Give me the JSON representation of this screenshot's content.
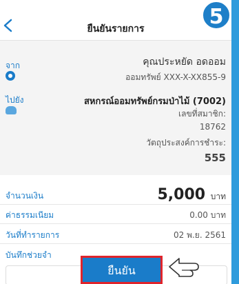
{
  "header": {
    "title": "ยืนยันรายการ",
    "step_number": "5"
  },
  "from": {
    "label": "จาก",
    "name": "คุณประหยัด อดออม",
    "account": "ออมทรัพย์ XXX-X-XX855-9"
  },
  "to": {
    "label": "ไปยัง",
    "name": "สหกรณ์ออมทรัพย์กรมป่าไม้ (7002)",
    "member_label": "เลขที่สมาชิก:",
    "member_number": "18762",
    "purpose_label": "วัตถุประสงค์การชำระ:",
    "purpose_value": "555"
  },
  "details": {
    "amount_label": "จำนวนเงิน",
    "amount_value": "5,000",
    "amount_unit": "บาท",
    "fee_label": "ค่าธรรมเนียม",
    "fee_value": "0.00 บาท",
    "date_label": "วันที่ทำรายการ",
    "date_value": "02 พ.ย. 2561",
    "memo_label": "บันทึกช่วยจำ"
  },
  "actions": {
    "confirm_label": "ยืนยัน"
  },
  "colors": {
    "accent": "#1a7cc9",
    "highlight_border": "#e0242b",
    "frame": "#2e9bdc"
  }
}
